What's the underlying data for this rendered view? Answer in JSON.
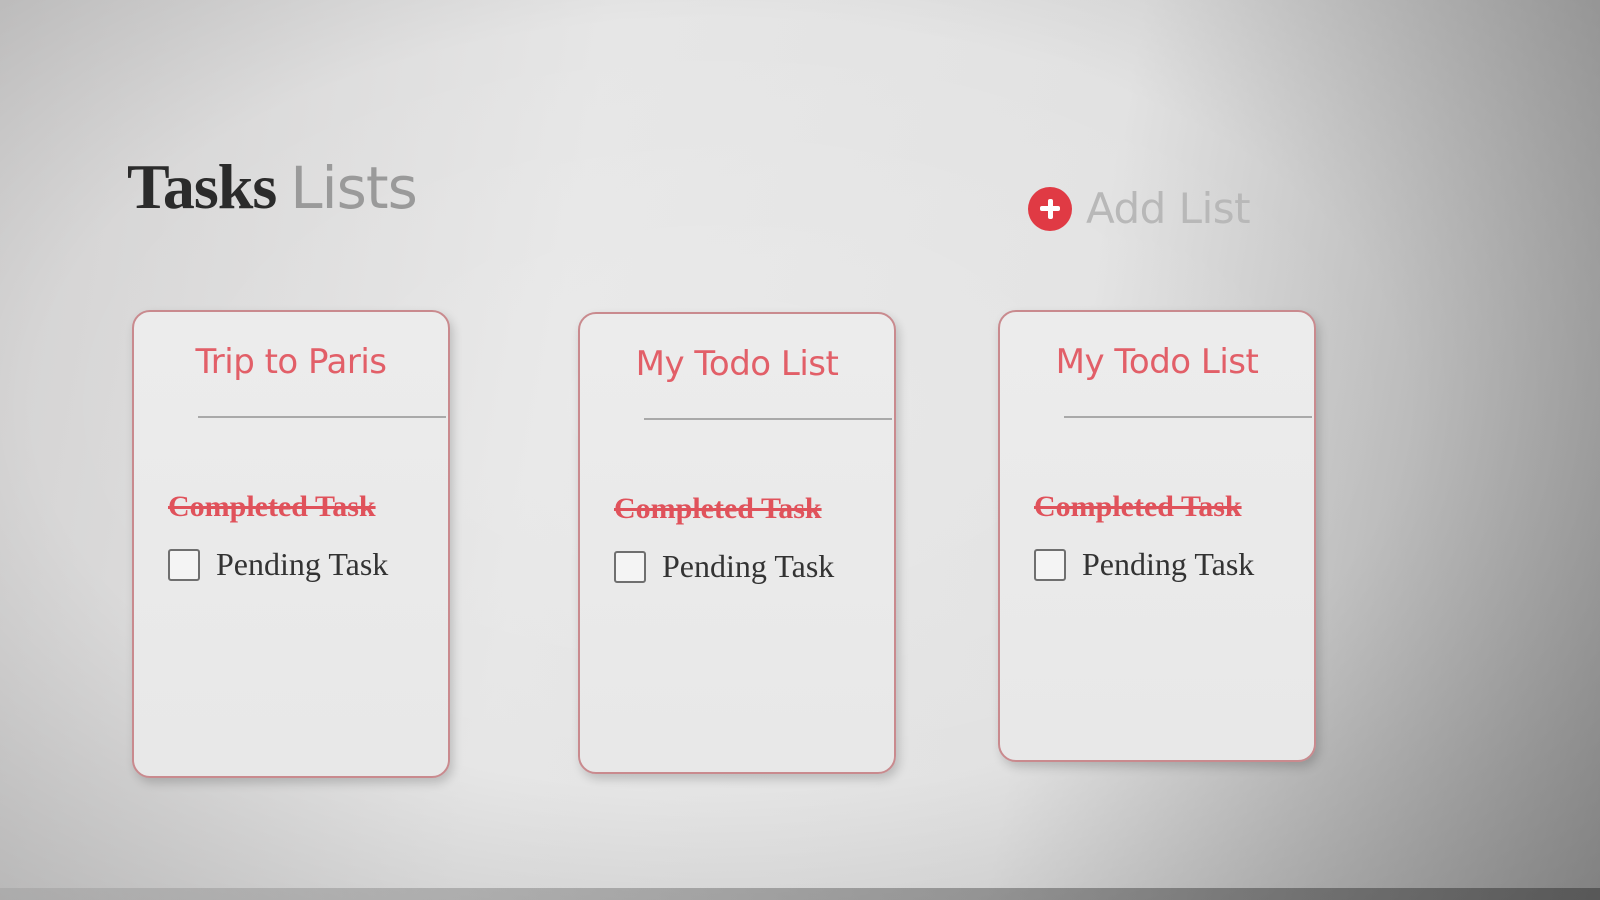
{
  "header": {
    "title_bold": "Tasks",
    "title_light": "Lists"
  },
  "add_list": {
    "label": "Add List",
    "icon": "plus-circle-icon",
    "icon_color": "#e03a44"
  },
  "colors": {
    "accent": "#e25f68",
    "completed_text": "#e0525b",
    "card_border": "#c98a8e"
  },
  "lists": [
    {
      "title": "Trip to Paris",
      "completed_task": "Completed Task",
      "pending_task": "Pending Task",
      "pending_checked": false
    },
    {
      "title": "My Todo List",
      "completed_task": "Completed Task",
      "pending_task": "Pending Task",
      "pending_checked": false
    },
    {
      "title": "My Todo List",
      "completed_task": "Completed Task",
      "pending_task": "Pending Task",
      "pending_checked": false
    }
  ]
}
